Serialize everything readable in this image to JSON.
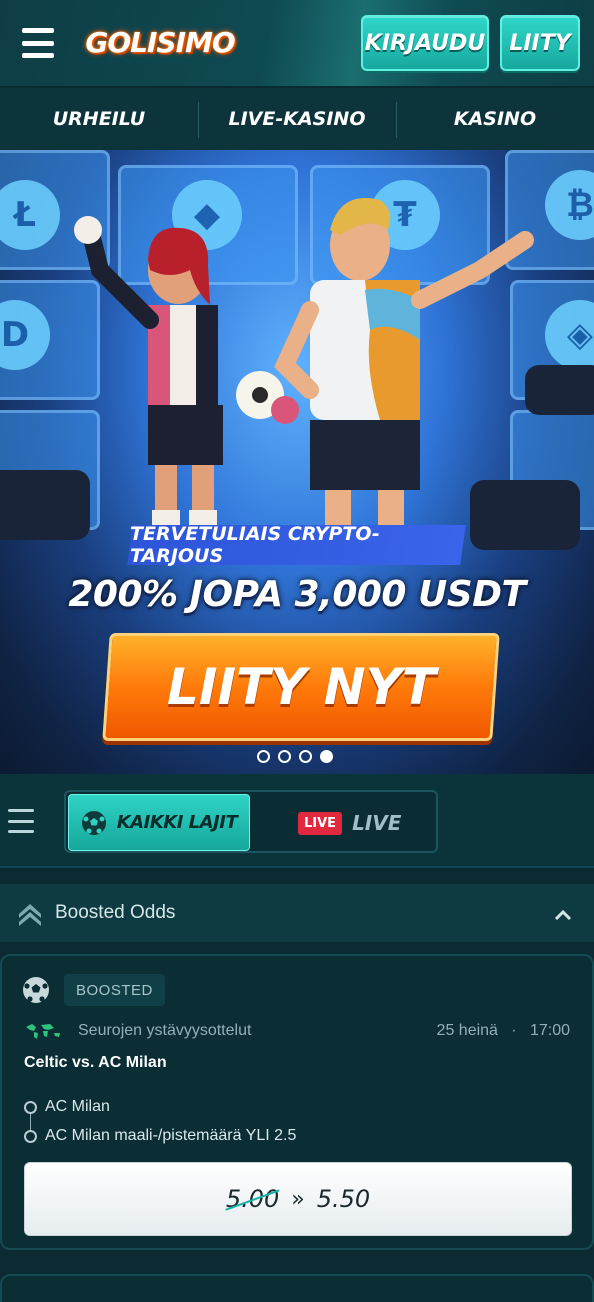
{
  "header": {
    "logo_text": "GOLISIMO",
    "login_label": "KIRJAUDU",
    "join_label": "LIITY"
  },
  "nav": {
    "items": [
      {
        "label": "URHEILU"
      },
      {
        "label": "LIVE-KASINO"
      },
      {
        "label": "KASINO"
      }
    ]
  },
  "banner": {
    "tag": "TERVETULIAIS CRYPTO-TARJOUS",
    "headline": "200% JOPA 3,000 USDT",
    "cta": "LIITY NYT",
    "slide_count": 4,
    "active_slide": 4
  },
  "sportbar": {
    "all_label": "KAIKKI LAJIT",
    "live_badge": "LIVE",
    "live_label": "LIVE"
  },
  "boosted": {
    "title": "Boosted Odds",
    "card": {
      "pill": "BOOSTED",
      "league": "Seurojen ystävyysottelut",
      "date": "25 heinä",
      "time": "17:00",
      "home": "Celtic",
      "vs": "vs.",
      "away": "AC Milan",
      "selections": [
        "AC Milan",
        "AC Milan maali-/pistemäärä YLI 2.5"
      ],
      "old_odds": "5.00",
      "arrow": "»",
      "new_odds": "5.50"
    }
  },
  "colors": {
    "accent_teal": "#2fd3c4",
    "cta_orange": "#ff7a0a",
    "live_red": "#e0283f",
    "background": "#0b2a31"
  }
}
